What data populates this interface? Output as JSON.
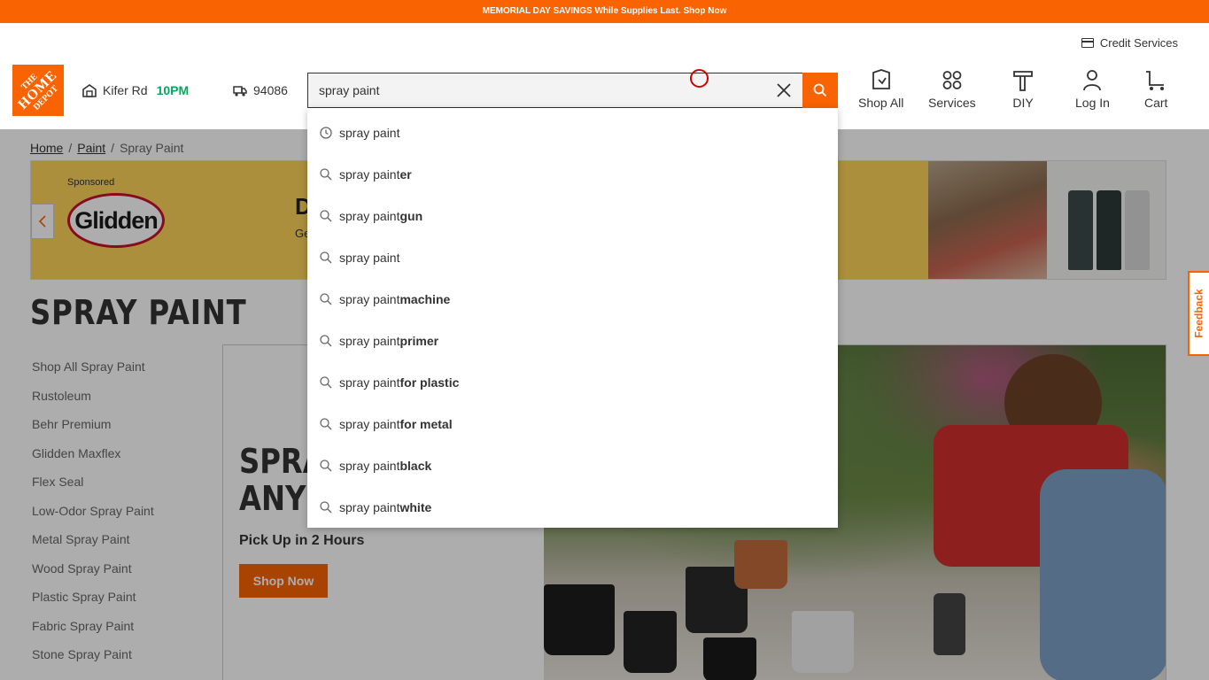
{
  "promo": {
    "text": "MEMORIAL DAY SAVINGS While Supplies Last. Shop Now"
  },
  "header": {
    "credit_services": "Credit Services",
    "logo_line1": "THE",
    "logo_line2": "HOME",
    "logo_line3": "DEPOT",
    "store_name": "Kifer Rd",
    "store_hours": "10PM",
    "zip": "94086",
    "search": {
      "value": "spray paint"
    },
    "nav": {
      "shop_all": "Shop All",
      "services": "Services",
      "diy": "DIY",
      "log_in": "Log In",
      "cart": "Cart"
    }
  },
  "breadcrumb": {
    "home": "Home",
    "paint": "Paint",
    "current": "Spray Paint",
    "sep": "/"
  },
  "banner": {
    "sponsored": "Sponsored",
    "brand": "Glidden",
    "heading_partial": "D",
    "sub_partial": "Ge"
  },
  "category_title": "SPRAY PAINT",
  "side_nav": [
    "Shop All Spray Paint",
    "Rustoleum",
    "Behr Premium",
    "Glidden Maxflex",
    "Flex Seal",
    "Low-Odor Spray Paint",
    "Metal Spray Paint",
    "Wood Spray Paint",
    "Plastic Spray Paint",
    "Fabric Spray Paint",
    "Stone Spray Paint"
  ],
  "hero": {
    "title_line1": "SPRA",
    "title_line2": "ANY",
    "subtitle": "Pick Up in 2 Hours",
    "button": "Shop Now"
  },
  "suggestions": [
    {
      "base": "spray paint",
      "bold": "",
      "icon": "history-clock-icon"
    },
    {
      "base": "spray paint",
      "bold": "er",
      "icon": "search-icon"
    },
    {
      "base": "spray paint ",
      "bold": "gun",
      "icon": "search-icon"
    },
    {
      "base": "spray paint",
      "bold": "",
      "icon": "search-icon"
    },
    {
      "base": "spray paint ",
      "bold": "machine",
      "icon": "search-icon"
    },
    {
      "base": "spray paint ",
      "bold": "primer",
      "icon": "search-icon"
    },
    {
      "base": "spray paint ",
      "bold": "for plastic",
      "icon": "search-icon"
    },
    {
      "base": "spray paint ",
      "bold": "for metal",
      "icon": "search-icon"
    },
    {
      "base": "spray paint ",
      "bold": "black",
      "icon": "search-icon"
    },
    {
      "base": "spray paint ",
      "bold": "white",
      "icon": "search-icon"
    }
  ],
  "feedback": "Feedback",
  "colors": {
    "brand_orange": "#f96302",
    "store_green": "#00a960",
    "banner_yellow": "#fdd35a"
  }
}
